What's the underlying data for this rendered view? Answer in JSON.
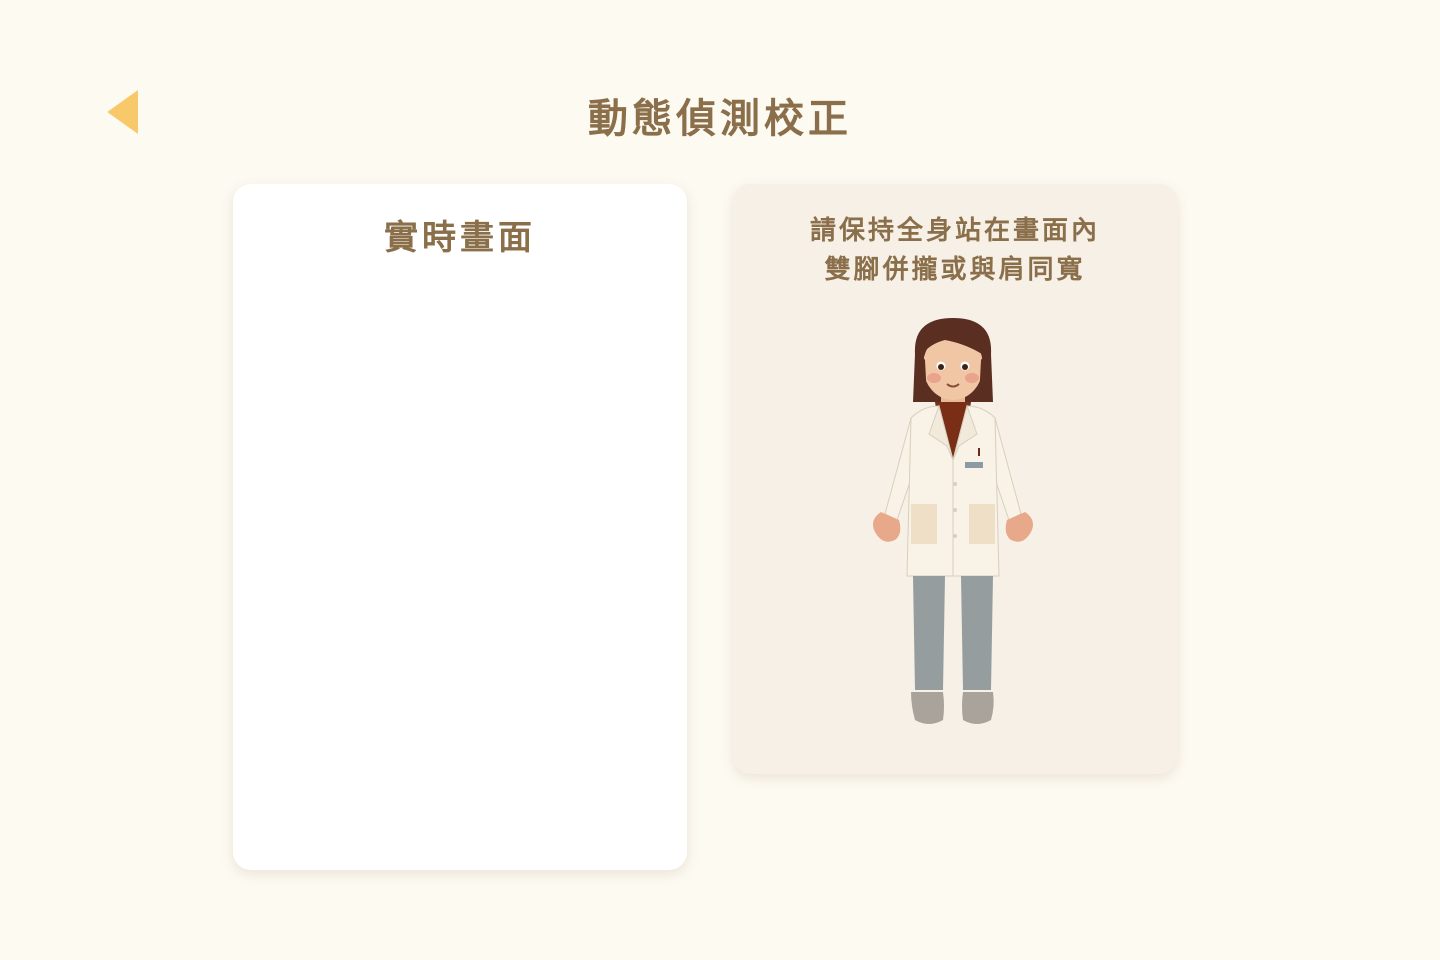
{
  "header": {
    "title": "動態偵測校正",
    "back_icon": "back-arrow-icon"
  },
  "live_panel": {
    "title": "實時畫面"
  },
  "guide_panel": {
    "instruction_line1": "請保持全身站在畫面內",
    "instruction_line2": "雙腳併攏或與肩同寬",
    "figure": "doctor-standing-illustration"
  },
  "colors": {
    "background": "#fdfaf2",
    "title_text": "#8a6f4a",
    "back_arrow": "#f7c96b",
    "live_panel_bg": "#ffffff",
    "guide_panel_bg": "#f6f0e6"
  }
}
